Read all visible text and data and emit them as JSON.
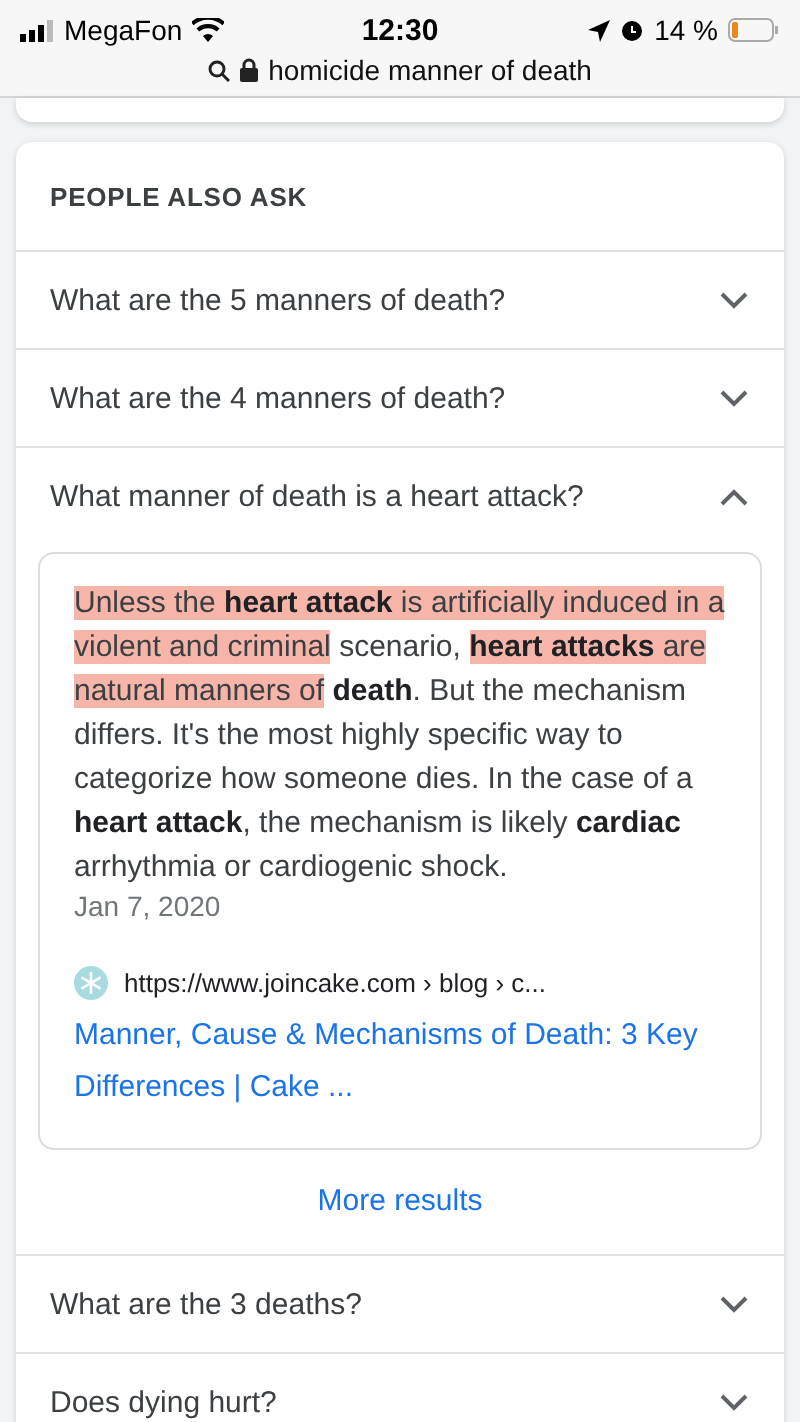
{
  "status_bar": {
    "carrier": "MegaFon",
    "time": "12:30",
    "battery": "14 %"
  },
  "address_bar": {
    "query": "homicide manner of death"
  },
  "people_also_ask": {
    "heading": "PEOPLE ALSO ASK",
    "questions": [
      {
        "text": "What are the 5 manners of death?",
        "expanded": false
      },
      {
        "text": "What are the 4 manners of death?",
        "expanded": false
      },
      {
        "text": "What manner of death is a heart attack?",
        "expanded": true,
        "answer": {
          "segments": [
            {
              "text": "Unless the **heart attack** is ",
              "highlighted": true
            },
            {
              "text": "artificially induced in a violent and criminal",
              "highlighted": true
            },
            {
              "text": " scenario, ",
              "highlighted": false
            },
            {
              "text": "**heart attacks** are natural manners of",
              "highlighted": true
            },
            {
              "text": " **death**. But the mechanism differs. It's the most highly specific way to categorize how someone dies. In the case of a **heart attack**, the mechanism is likely **cardiac** arrhythmia or cardiogenic shock.",
              "highlighted": false
            }
          ],
          "date": "Jan 7, 2020",
          "source_url": "https://www.joincake.com › blog › c...",
          "link_title": "Manner, Cause & Mechanisms of Death: 3 Key Differences | Cake ..."
        }
      },
      {
        "text": "What are the 3 deaths?",
        "expanded": false
      },
      {
        "text": "Does dying hurt?",
        "expanded": false
      }
    ],
    "more_results": "More results"
  }
}
